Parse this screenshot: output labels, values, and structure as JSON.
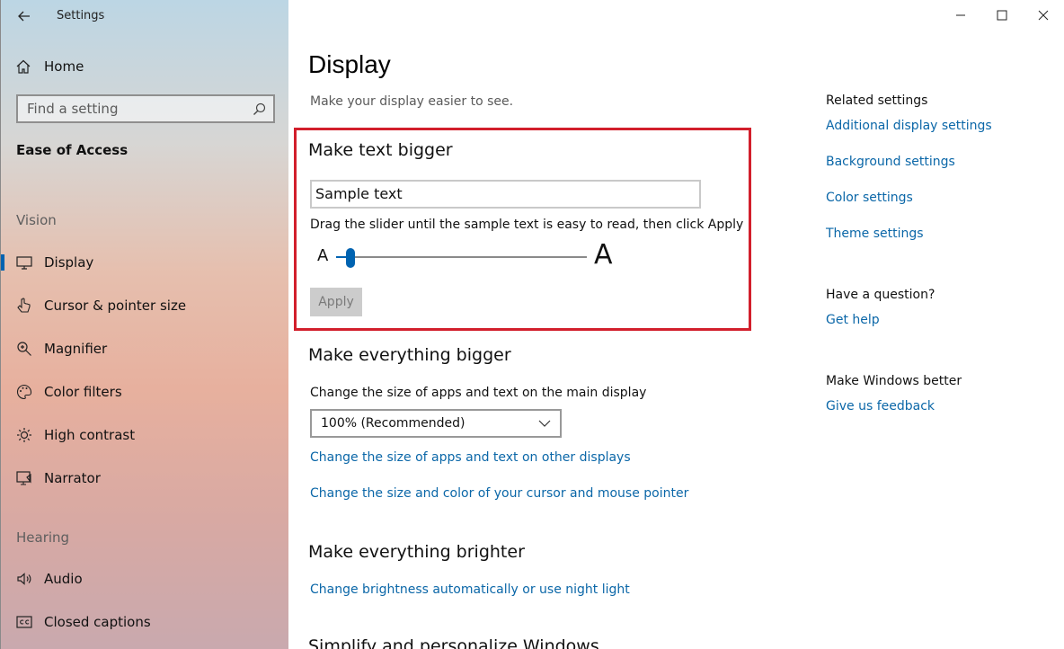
{
  "app": {
    "title": "Settings"
  },
  "sidebar": {
    "home_label": "Home",
    "search_placeholder": "Find a setting",
    "section_title": "Ease of Access",
    "groups": [
      {
        "label": "Vision"
      },
      {
        "label": "Hearing"
      }
    ],
    "items": [
      {
        "label": "Display",
        "icon": "monitor-icon",
        "active": true
      },
      {
        "label": "Cursor & pointer size",
        "icon": "pointer-icon"
      },
      {
        "label": "Magnifier",
        "icon": "magnifier-icon"
      },
      {
        "label": "Color filters",
        "icon": "palette-icon"
      },
      {
        "label": "High contrast",
        "icon": "sun-icon"
      },
      {
        "label": "Narrator",
        "icon": "narrator-icon"
      },
      {
        "label": "Audio",
        "icon": "speaker-icon"
      },
      {
        "label": "Closed captions",
        "icon": "cc-icon"
      }
    ]
  },
  "main": {
    "title": "Display",
    "subtitle": "Make your display easier to see.",
    "text_bigger": {
      "heading": "Make text bigger",
      "sample": "Sample text",
      "instruction": "Drag the slider until the sample text is easy to read, then click Apply",
      "small_a": "A",
      "big_a": "A",
      "slider_value": 0.04,
      "apply_label": "Apply"
    },
    "everything_bigger": {
      "heading": "Make everything bigger",
      "description": "Change the size of apps and text on the main display",
      "scale_value": "100% (Recommended)",
      "link_other_displays": "Change the size of apps and text on other displays",
      "link_cursor": "Change the size and color of your cursor and mouse pointer"
    },
    "everything_brighter": {
      "heading": "Make everything brighter",
      "link_brightness": "Change brightness automatically or use night light"
    },
    "simplify": {
      "heading": "Simplify and personalize Windows"
    }
  },
  "rail": {
    "related_heading": "Related settings",
    "related_links": [
      "Additional display settings",
      "Background settings",
      "Color settings",
      "Theme settings"
    ],
    "question_heading": "Have a question?",
    "get_help": "Get help",
    "better_heading": "Make Windows better",
    "feedback": "Give us feedback"
  },
  "colors": {
    "accent": "#0063b1",
    "link": "#0b67a8",
    "highlight": "#d21f2c"
  }
}
